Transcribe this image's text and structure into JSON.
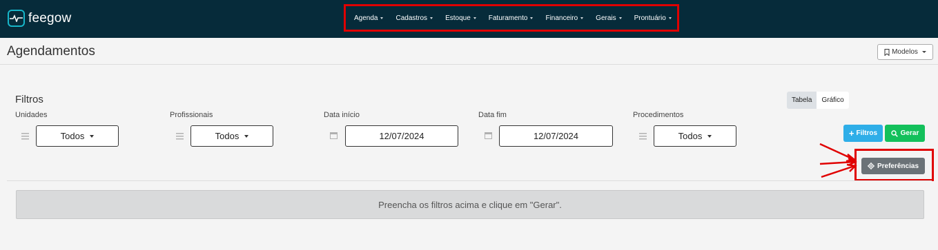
{
  "app": {
    "logo_text": "feegow",
    "accent_color": "#17b6c9",
    "navbar_color": "#062b3a"
  },
  "nav": {
    "items": [
      {
        "label": "Agenda"
      },
      {
        "label": "Cadastros"
      },
      {
        "label": "Estoque"
      },
      {
        "label": "Faturamento"
      },
      {
        "label": "Financeiro"
      },
      {
        "label": "Gerais"
      },
      {
        "label": "Prontuário"
      }
    ]
  },
  "header": {
    "title": "Agendamentos",
    "modelos_label": "Modelos",
    "modelos_icon": "bookmark-icon"
  },
  "filters": {
    "title": "Filtros",
    "view_toggle": {
      "tabela": "Tabela",
      "grafico": "Gráfico",
      "active": "Tabela"
    },
    "unidades": {
      "label": "Unidades",
      "value": "Todos",
      "icon": "drag-handle-icon"
    },
    "profissionais": {
      "label": "Profissionais",
      "value": "Todos",
      "icon": "drag-handle-icon"
    },
    "data_inicio": {
      "label": "Data início",
      "value": "12/07/2024",
      "icon": "calendar-icon"
    },
    "data_fim": {
      "label": "Data fim",
      "value": "12/07/2024",
      "icon": "calendar-icon"
    },
    "procedimentos": {
      "label": "Procedimentos",
      "value": "Todos",
      "icon": "drag-handle-icon"
    }
  },
  "actions": {
    "filtros_label": "Filtros",
    "gerar_label": "Gerar",
    "preferencias_label": "Preferências",
    "filtros_color": "#2eaee8",
    "gerar_color": "#13c05b",
    "preferencias_color": "#6b7277"
  },
  "annotation_color": "#e00000",
  "message": {
    "text": "Preencha os filtros acima e clique em \"Gerar\"."
  }
}
